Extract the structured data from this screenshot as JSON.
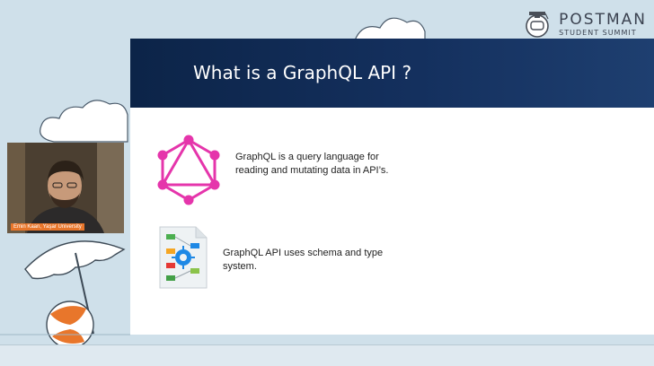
{
  "brand": {
    "name": "POSTMAN",
    "subtitle": "STUDENT SUMMIT"
  },
  "slide": {
    "title": "What is a GraphQL API ?",
    "points": [
      "GraphQL is a query language for reading and mutating data in API’s.",
      "GraphQL API uses schema and type system."
    ]
  },
  "webcam": {
    "name_tag": "Emin Kaan, Yaşar University"
  },
  "colors": {
    "header": "#0c2448",
    "graphql": "#e535ab",
    "name_tag": "#e8762b",
    "background": "#cfe0ea"
  },
  "icons": [
    "postman-astronaut-logo-icon",
    "graphql-logo-icon",
    "schema-diagram-icon"
  ]
}
